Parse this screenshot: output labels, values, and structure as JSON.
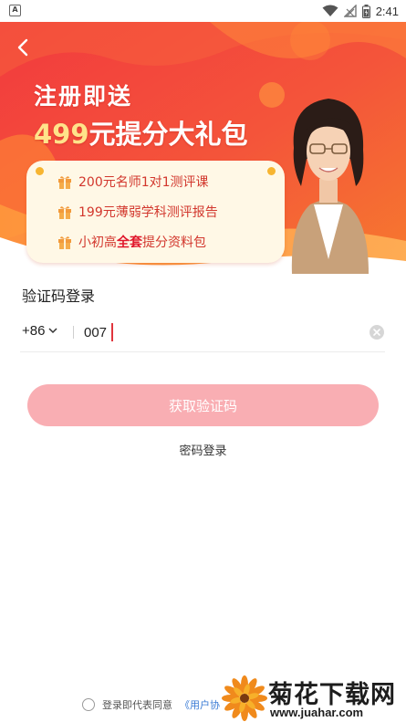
{
  "status_bar": {
    "app_icon_letter": "A",
    "time": "2:41",
    "icons": [
      "wifi-icon",
      "signal-off-icon",
      "battery-icon"
    ]
  },
  "banner": {
    "title_line1": "注册即送",
    "title_line2_highlight": "499",
    "title_line2_rest": "元提分大礼包",
    "benefits": [
      {
        "icon": "gift-icon",
        "highlight": "200元",
        "text": "名师1对1测评课"
      },
      {
        "icon": "gift-icon",
        "highlight": "199元",
        "text": "薄弱学科测评报告"
      },
      {
        "icon": "gift-icon",
        "pre": "小初高",
        "highlight": "全套",
        "text": "提分资料包"
      }
    ]
  },
  "login": {
    "title": "验证码登录",
    "country_code": "+86",
    "phone_value": "007",
    "get_code_label": "获取验证码",
    "password_login_label": "密码登录"
  },
  "agreement": {
    "text": "登录即代表同意",
    "link_text": "《用户协"
  },
  "watermark": {
    "title": "菊花下载网",
    "url": "www.juahar.com"
  },
  "colors": {
    "brand_red": "#f0413a",
    "button_disabled_pink": "#f9aeb3",
    "highlight_yellow": "#ffe38a",
    "benefit_text": "#d2372d",
    "link_blue": "#3a7bd5"
  }
}
